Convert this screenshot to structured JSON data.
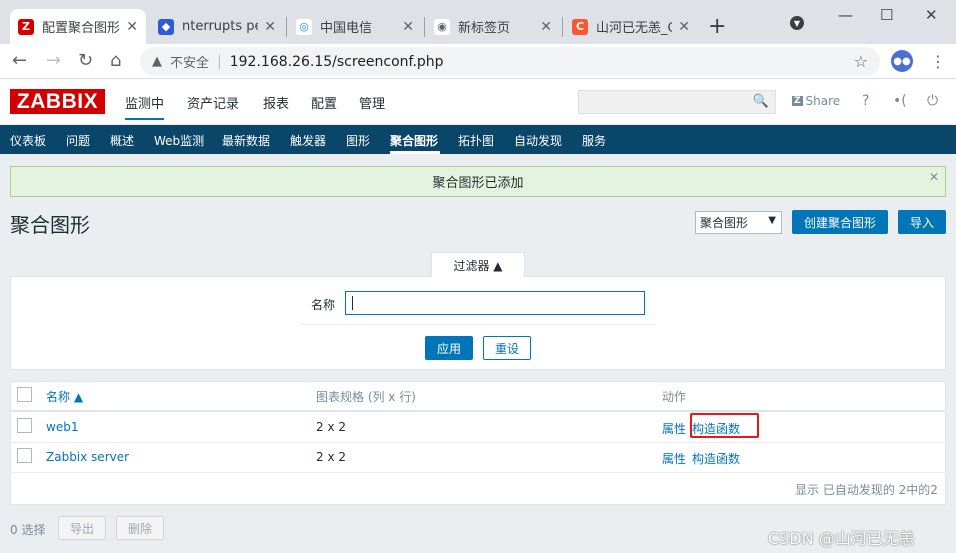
{
  "browser": {
    "tabs": [
      {
        "title": "配置聚合图形",
        "favicon": "Z",
        "color": "#d40000",
        "active": true
      },
      {
        "title": "nterrupts per",
        "favicon": "◆",
        "color": "#2f5ad8",
        "active": false
      },
      {
        "title": "中国电信",
        "favicon": "◎",
        "color": "#1e88e5",
        "active": false
      },
      {
        "title": "新标签页",
        "favicon": "◉",
        "color": "#5f6368",
        "active": false
      },
      {
        "title": "山河已无恙_C",
        "favicon": "C",
        "color": "#fc5531",
        "active": false
      }
    ],
    "insecure_label": "不安全",
    "url": "192.168.26.15/screenconf.php"
  },
  "header": {
    "logo": "ZABBIX",
    "menu": [
      "监测中",
      "资产记录",
      "报表",
      "配置",
      "管理"
    ],
    "share_label": "Share"
  },
  "submenu": [
    "仪表板",
    "问题",
    "概述",
    "Web监测",
    "最新数据",
    "触发器",
    "图形",
    "聚合图形",
    "拓扑图",
    "自动发现",
    "服务"
  ],
  "message": "聚合图形已添加",
  "page": {
    "title": "聚合图形",
    "select_value": "聚合图形",
    "create_button": "创建聚合图形",
    "import_button": "导入"
  },
  "filter": {
    "tab_label": "过滤器 ▲",
    "name_label": "名称",
    "name_value": "",
    "apply_button": "应用",
    "reset_button": "重设"
  },
  "table": {
    "headers": {
      "name": "名称 ▲",
      "dimension": "图表规格 (列 x 行)",
      "actions": "动作"
    },
    "rows": [
      {
        "name": "web1",
        "dimension": "2 x 2",
        "properties": "属性",
        "constructor": "构造函数"
      },
      {
        "name": "Zabbix server",
        "dimension": "2 x 2",
        "properties": "属性",
        "constructor": "构造函数"
      }
    ],
    "footer": "显示 已自动发现的 2中的2"
  },
  "bottom": {
    "selected": "0 选择",
    "export_button": "导出",
    "delete_button": "删除"
  },
  "watermark": "CSDN @山河已无恙"
}
